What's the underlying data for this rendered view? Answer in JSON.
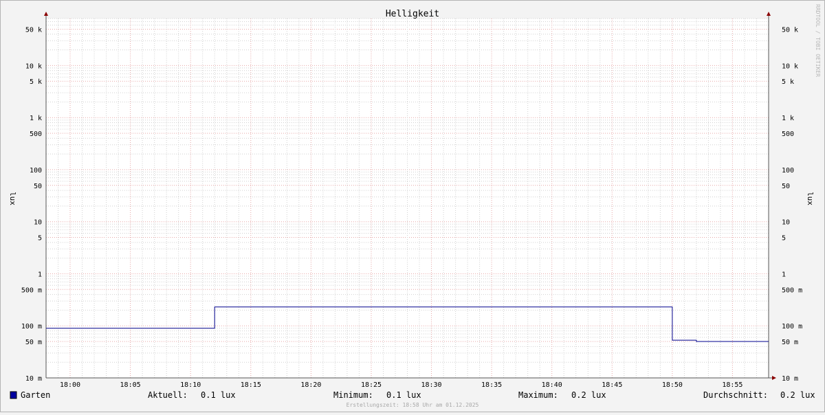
{
  "chart_data": {
    "type": "line",
    "title": "Helligkeit",
    "ylabel": "lux",
    "yscale": "log",
    "ylim": [
      0.01,
      80000
    ],
    "xlim": [
      "17:58",
      "18:58"
    ],
    "x_ticks": [
      "18:00",
      "18:05",
      "18:10",
      "18:15",
      "18:20",
      "18:25",
      "18:30",
      "18:35",
      "18:40",
      "18:45",
      "18:50",
      "18:55"
    ],
    "y_ticks": [
      {
        "value": 0.01,
        "label": "10 m"
      },
      {
        "value": 0.05,
        "label": "50 m"
      },
      {
        "value": 0.1,
        "label": "100 m"
      },
      {
        "value": 0.5,
        "label": "500 m"
      },
      {
        "value": 1,
        "label": "1"
      },
      {
        "value": 5,
        "label": "5"
      },
      {
        "value": 10,
        "label": "10"
      },
      {
        "value": 50,
        "label": "50"
      },
      {
        "value": 100,
        "label": "100"
      },
      {
        "value": 500,
        "label": "500"
      },
      {
        "value": 1000,
        "label": "1 k"
      },
      {
        "value": 5000,
        "label": "5 k"
      },
      {
        "value": 10000,
        "label": "10 k"
      },
      {
        "value": 50000,
        "label": "50 k"
      }
    ],
    "grid": true,
    "series": [
      {
        "name": "Garten",
        "color": "#00008c",
        "step": true,
        "x": [
          "17:58",
          "18:12",
          "18:12",
          "18:50",
          "18:50",
          "18:52",
          "18:52",
          "18:58"
        ],
        "y": [
          0.09,
          0.09,
          0.23,
          0.23,
          0.053,
          0.053,
          0.05,
          0.05
        ]
      }
    ],
    "legend": {
      "position": "bottom",
      "series_label": "Garten",
      "swatch_color": "#0000a0",
      "stats": [
        {
          "label": "Aktuell:",
          "value": "0.1 lux"
        },
        {
          "label": "Minimum:",
          "value": "0.1 lux"
        },
        {
          "label": "Maximum:",
          "value": "0.2 lux"
        },
        {
          "label": "Durchschnitt:",
          "value": "0.2 lux"
        }
      ]
    },
    "footer": "Erstellungszeit: 18:58 Uhr am 01.12.2025",
    "watermark": "RRDTOOL / TOBI OETIKER"
  },
  "colors": {
    "background": "#f3f3f3",
    "plot_background": "#ffffff",
    "major_grid": "#e7a6a6",
    "minor_grid": "#d0d0d0",
    "axis": "#555555",
    "arrow": "#8b0000"
  }
}
